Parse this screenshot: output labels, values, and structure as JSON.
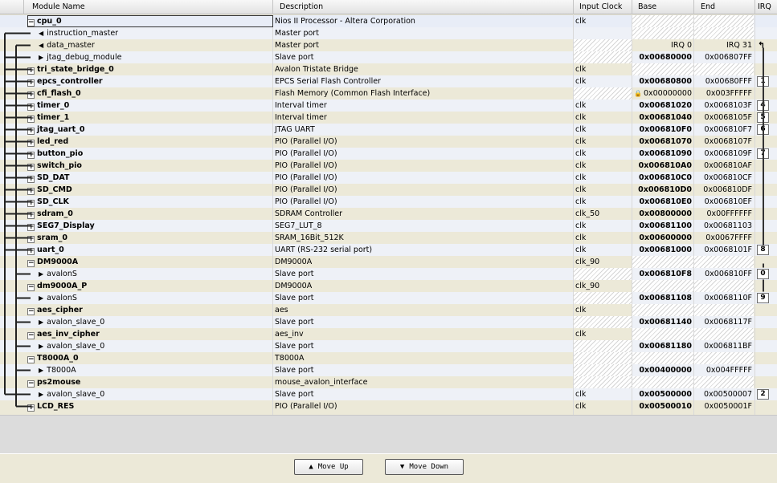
{
  "columns": {
    "name": "Module Name",
    "desc": "Description",
    "clock": "Input Clock",
    "base": "Base",
    "end": "End",
    "irq": "IRQ"
  },
  "rows": [
    {
      "name": "cpu_0",
      "bold": true,
      "expander": "minus",
      "desc": "Nios II Processor - Altera Corporation",
      "clock": "clk",
      "base": "",
      "end": "",
      "irq": "",
      "hatch": "be"
    },
    {
      "name": "instruction_master",
      "child": true,
      "arrow": "left",
      "desc": "Master port",
      "clock": "",
      "base": "",
      "end": "",
      "irq": "",
      "hatch": "be"
    },
    {
      "name": "data_master",
      "child": true,
      "arrow": "left",
      "desc": "Master port",
      "clock": "",
      "base": "IRQ 0",
      "end": "IRQ 31",
      "irq": "",
      "irqglyph": "↰",
      "hatch": "c"
    },
    {
      "name": "jtag_debug_module",
      "child": true,
      "arrow": "right",
      "desc": "Slave port",
      "clock": "",
      "base": "0x00680000",
      "end": "0x006807FF",
      "irq": "",
      "hatch": "c"
    },
    {
      "name": "tri_state_bridge_0",
      "bold": true,
      "expander": "plus",
      "desc": "Avalon Tristate Bridge",
      "clock": "clk",
      "base": "",
      "end": "",
      "irq": "",
      "hatch": "be"
    },
    {
      "name": "epcs_controller",
      "bold": true,
      "expander": "plus",
      "desc": "EPCS Serial Flash Controller",
      "clock": "clk",
      "base": "0x00680800",
      "end": "0x00680FFF",
      "irq": "1"
    },
    {
      "name": "cfi_flash_0",
      "bold": true,
      "expander": "plus",
      "desc": "Flash Memory (Common Flash Interface)",
      "clock": "",
      "base": "0x00000000",
      "lock": true,
      "end": "0x003FFFFF",
      "irq": "",
      "hatch": "c"
    },
    {
      "name": "timer_0",
      "bold": true,
      "expander": "plus",
      "desc": "Interval timer",
      "clock": "clk",
      "base": "0x00681020",
      "end": "0x0068103F",
      "irq": "4"
    },
    {
      "name": "timer_1",
      "bold": true,
      "expander": "plus",
      "desc": "Interval timer",
      "clock": "clk",
      "base": "0x00681040",
      "end": "0x0068105F",
      "irq": "5"
    },
    {
      "name": "jtag_uart_0",
      "bold": true,
      "expander": "plus",
      "desc": "JTAG UART",
      "clock": "clk",
      "base": "0x006810F0",
      "end": "0x006810F7",
      "irq": "6"
    },
    {
      "name": "led_red",
      "bold": true,
      "expander": "plus",
      "desc": "PIO (Parallel I/O)",
      "clock": "clk",
      "base": "0x00681070",
      "end": "0x0068107F",
      "irq": ""
    },
    {
      "name": "button_pio",
      "bold": true,
      "expander": "plus",
      "desc": "PIO (Parallel I/O)",
      "clock": "clk",
      "base": "0x00681090",
      "end": "0x0068109F",
      "irq": "7"
    },
    {
      "name": "switch_pio",
      "bold": true,
      "expander": "plus",
      "desc": "PIO (Parallel I/O)",
      "clock": "clk",
      "base": "0x006810A0",
      "end": "0x006810AF",
      "irq": ""
    },
    {
      "name": "SD_DAT",
      "bold": true,
      "expander": "plus",
      "desc": "PIO (Parallel I/O)",
      "clock": "clk",
      "base": "0x006810C0",
      "end": "0x006810CF",
      "irq": ""
    },
    {
      "name": "SD_CMD",
      "bold": true,
      "expander": "plus",
      "desc": "PIO (Parallel I/O)",
      "clock": "clk",
      "base": "0x006810D0",
      "end": "0x006810DF",
      "irq": ""
    },
    {
      "name": "SD_CLK",
      "bold": true,
      "expander": "plus",
      "desc": "PIO (Parallel I/O)",
      "clock": "clk",
      "base": "0x006810E0",
      "end": "0x006810EF",
      "irq": ""
    },
    {
      "name": "sdram_0",
      "bold": true,
      "expander": "plus",
      "desc": "SDRAM Controller",
      "clock": "clk_50",
      "base": "0x00800000",
      "end": "0x00FFFFFF",
      "irq": ""
    },
    {
      "name": "SEG7_Display",
      "bold": true,
      "expander": "plus",
      "desc": "SEG7_LUT_8",
      "clock": "clk",
      "base": "0x00681100",
      "end": "0x00681103",
      "irq": ""
    },
    {
      "name": "sram_0",
      "bold": true,
      "expander": "plus",
      "desc": "SRAM_16Bit_512K",
      "clock": "clk",
      "base": "0x00600000",
      "end": "0x0067FFFF",
      "irq": ""
    },
    {
      "name": "uart_0",
      "bold": true,
      "expander": "plus",
      "desc": "UART (RS-232 serial port)",
      "clock": "clk",
      "base": "0x00681000",
      "end": "0x0068101F",
      "irq": "8"
    },
    {
      "name": "DM9000A",
      "bold": true,
      "expander": "minus",
      "desc": "DM9000A",
      "clock": "clk_90",
      "base": "",
      "end": "",
      "irq": "",
      "hatch": "be"
    },
    {
      "name": "avalonS",
      "child": true,
      "arrow": "right",
      "desc": "Slave port",
      "clock": "",
      "base": "0x006810F8",
      "end": "0x006810FF",
      "irq": "0",
      "hatch": "c"
    },
    {
      "name": "dm9000A_P",
      "bold": true,
      "expander": "minus",
      "desc": "DM9000A",
      "clock": "clk_90",
      "base": "",
      "end": "",
      "irq": "",
      "hatch": "be"
    },
    {
      "name": "avalonS",
      "child": true,
      "arrow": "right",
      "desc": "Slave port",
      "clock": "",
      "base": "0x00681108",
      "end": "0x0068110F",
      "irq": "9",
      "hatch": "c"
    },
    {
      "name": "aes_cipher",
      "bold": true,
      "expander": "minus",
      "desc": "aes",
      "clock": "clk",
      "base": "",
      "end": "",
      "irq": "",
      "hatch": "be"
    },
    {
      "name": "avalon_slave_0",
      "child": true,
      "arrow": "right",
      "desc": "Slave port",
      "clock": "",
      "base": "0x00681140",
      "end": "0x0068117F",
      "irq": "",
      "hatch": "c"
    },
    {
      "name": "aes_inv_cipher",
      "bold": true,
      "expander": "minus",
      "desc": "aes_inv",
      "clock": "clk",
      "base": "",
      "end": "",
      "irq": "",
      "hatch": "be"
    },
    {
      "name": "avalon_slave_0",
      "child": true,
      "arrow": "right",
      "desc": "Slave port",
      "clock": "",
      "base": "0x00681180",
      "end": "0x006811BF",
      "irq": "",
      "hatch": "c"
    },
    {
      "name": "T8000A_0",
      "bold": true,
      "expander": "minus",
      "desc": "T8000A",
      "clock": "",
      "base": "",
      "end": "",
      "irq": "",
      "hatch": "cbe"
    },
    {
      "name": "T8000A",
      "child": true,
      "arrow": "right",
      "desc": "Slave port",
      "clock": "",
      "base": "0x00400000",
      "end": "0x004FFFFF",
      "irq": "",
      "hatch": "c"
    },
    {
      "name": "ps2mouse",
      "bold": true,
      "expander": "minus",
      "desc": "mouse_avalon_interface",
      "clock": "",
      "base": "",
      "end": "",
      "irq": "",
      "hatch": "cbe"
    },
    {
      "name": "avalon_slave_0",
      "child": true,
      "arrow": "right",
      "desc": "Slave port",
      "clock": "clk",
      "base": "0x00500000",
      "end": "0x00500007",
      "irq": "2"
    },
    {
      "name": "LCD_RES",
      "bold": true,
      "expander": "plus",
      "desc": "PIO (Parallel I/O)",
      "clock": "clk",
      "base": "0x00500010",
      "end": "0x0050001F",
      "irq": ""
    }
  ],
  "buttons": {
    "move_up": "Move Up",
    "move_down": "Move Down"
  }
}
